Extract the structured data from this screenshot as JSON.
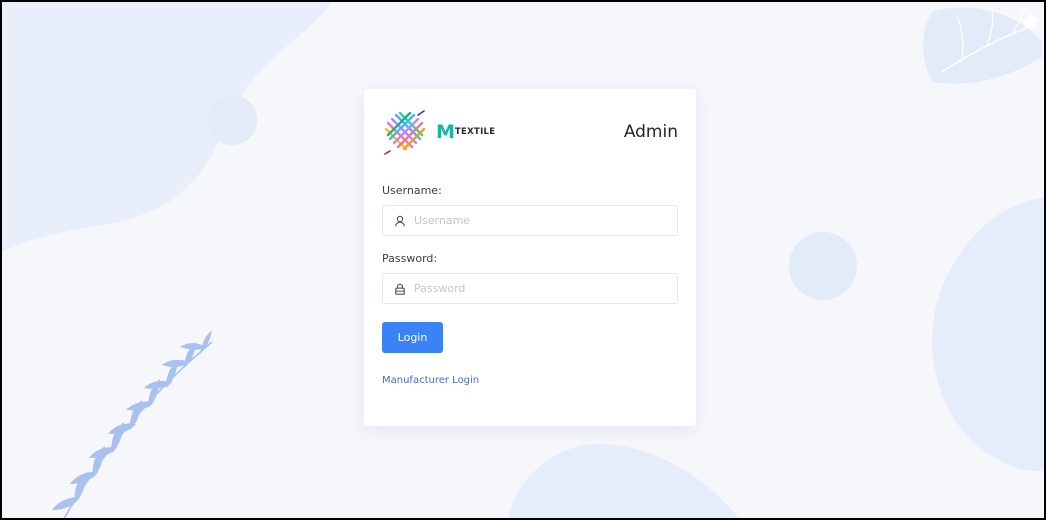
{
  "brand": {
    "mark": "M",
    "name": "TEXTILE"
  },
  "header": {
    "title": "Admin"
  },
  "form": {
    "username_label": "Username:",
    "username_placeholder": "Username",
    "username_value": "",
    "password_label": "Password:",
    "password_placeholder": "Password",
    "password_value": "",
    "login_label": "Login",
    "manufacturer_link": "Manufacturer Login"
  },
  "icons": {
    "username": "user-icon",
    "password": "lock-icon",
    "logo": "woven-textile-logo"
  },
  "colors": {
    "background": "#f5f7fb",
    "blob": "#e6edfa",
    "primary": "#3b82f6",
    "link": "#3b6fd4",
    "brand_teal": "#14b8a6"
  }
}
